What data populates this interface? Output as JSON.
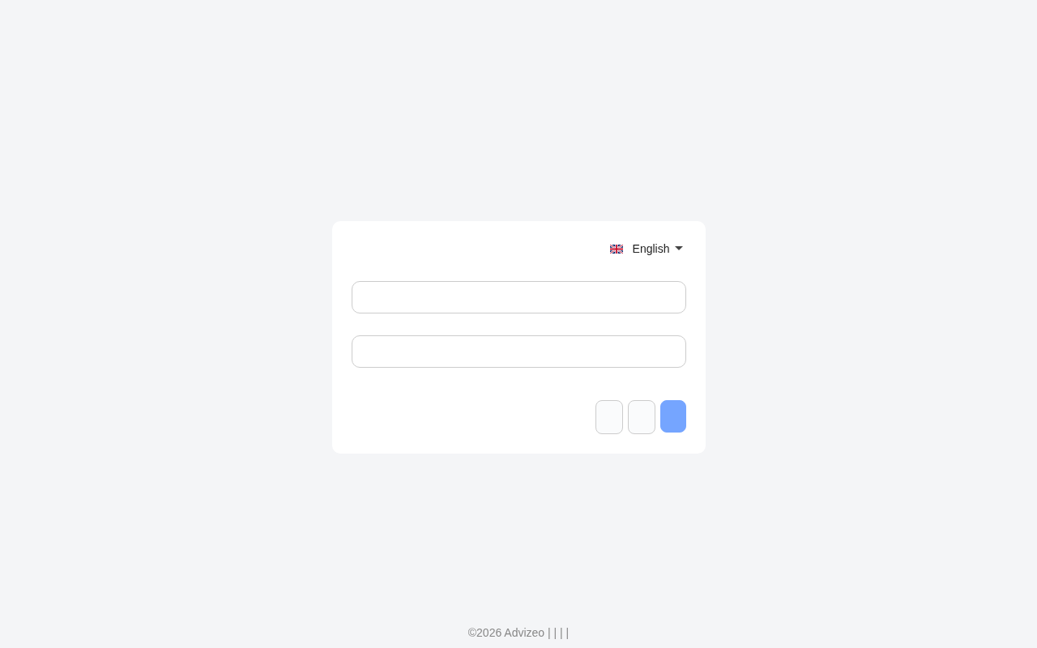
{
  "language": {
    "label": "English"
  },
  "fields": [
    {
      "kind": "input"
    },
    {
      "kind": "input"
    }
  ],
  "buttons": [
    {
      "kind": "secondary"
    },
    {
      "kind": "secondary"
    },
    {
      "kind": "primary"
    }
  ],
  "footer": {
    "text": "©2026 Advizeo | | | |"
  }
}
